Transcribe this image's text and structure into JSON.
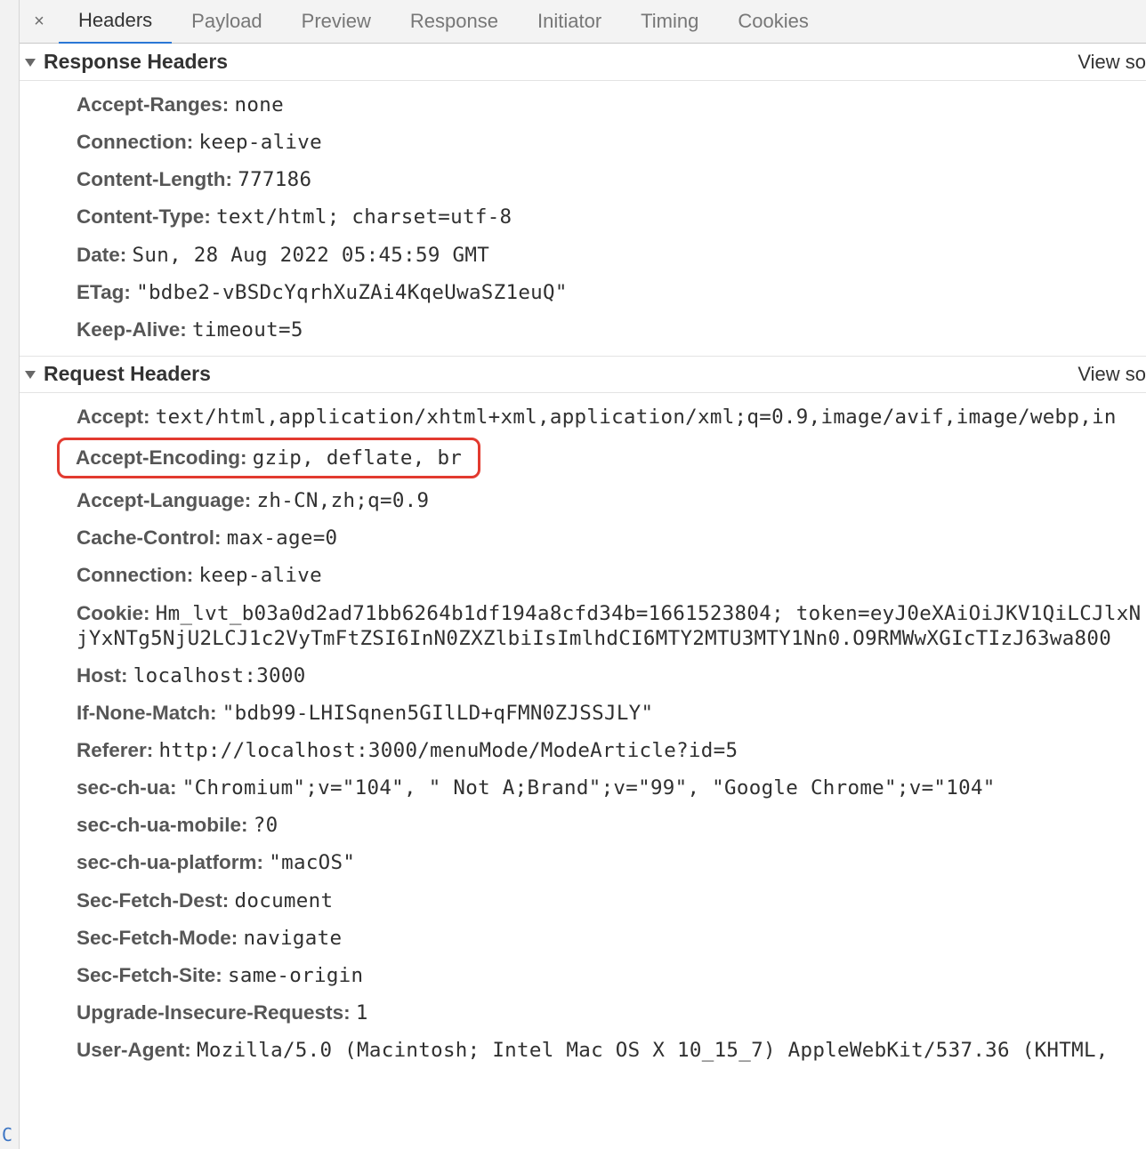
{
  "tabs": {
    "headers": "Headers",
    "payload": "Payload",
    "preview": "Preview",
    "response": "Response",
    "initiator": "Initiator",
    "timing": "Timing",
    "cookies": "Cookies"
  },
  "close_glyph": "×",
  "view_source_label": "View so",
  "response_section": {
    "title": "Response Headers",
    "items": [
      {
        "k": "Accept-Ranges",
        "v": "none"
      },
      {
        "k": "Connection",
        "v": "keep-alive"
      },
      {
        "k": "Content-Length",
        "v": "777186"
      },
      {
        "k": "Content-Type",
        "v": "text/html; charset=utf-8"
      },
      {
        "k": "Date",
        "v": "Sun, 28 Aug 2022 05:45:59 GMT"
      },
      {
        "k": "ETag",
        "v": "\"bdbe2-vBSDcYqrhXuZAi4KqeUwaSZ1euQ\""
      },
      {
        "k": "Keep-Alive",
        "v": "timeout=5"
      }
    ]
  },
  "request_section": {
    "title": "Request Headers",
    "items": [
      {
        "k": "Accept",
        "v": "text/html,application/xhtml+xml,application/xml;q=0.9,image/avif,image/webp,in"
      },
      {
        "k": "Accept-Encoding",
        "v": "gzip, deflate, br",
        "highlight": true
      },
      {
        "k": "Accept-Language",
        "v": "zh-CN,zh;q=0.9"
      },
      {
        "k": "Cache-Control",
        "v": "max-age=0"
      },
      {
        "k": "Connection",
        "v": "keep-alive"
      },
      {
        "k": "Cookie",
        "v": "Hm_lvt_b03a0d2ad71bb6264b1df194a8cfd34b=1661523804; token=eyJ0eXAiOiJKV1QiLCJlxNjYxNTg5NjU2LCJ1c2VyTmFtZSI6InN0ZXZlbiIsImlhdCI6MTY2MTU3MTY1Nn0.O9RMWwXGIcTIzJ63wa800"
      },
      {
        "k": "Host",
        "v": "localhost:3000"
      },
      {
        "k": "If-None-Match",
        "v": "\"bdb99-LHISqnen5GIlLD+qFMN0ZJSSJLY\""
      },
      {
        "k": "Referer",
        "v": "http://localhost:3000/menuMode/ModeArticle?id=5"
      },
      {
        "k": "sec-ch-ua",
        "v": "\"Chromium\";v=\"104\", \" Not A;Brand\";v=\"99\", \"Google Chrome\";v=\"104\""
      },
      {
        "k": "sec-ch-ua-mobile",
        "v": "?0"
      },
      {
        "k": "sec-ch-ua-platform",
        "v": "\"macOS\""
      },
      {
        "k": "Sec-Fetch-Dest",
        "v": "document"
      },
      {
        "k": "Sec-Fetch-Mode",
        "v": "navigate"
      },
      {
        "k": "Sec-Fetch-Site",
        "v": "same-origin"
      },
      {
        "k": "Upgrade-Insecure-Requests",
        "v": "1"
      },
      {
        "k": "User-Agent",
        "v": "Mozilla/5.0 (Macintosh; Intel Mac OS X 10_15_7) AppleWebKit/537.36 (KHTML,"
      }
    ]
  },
  "gutter_marker": "C"
}
